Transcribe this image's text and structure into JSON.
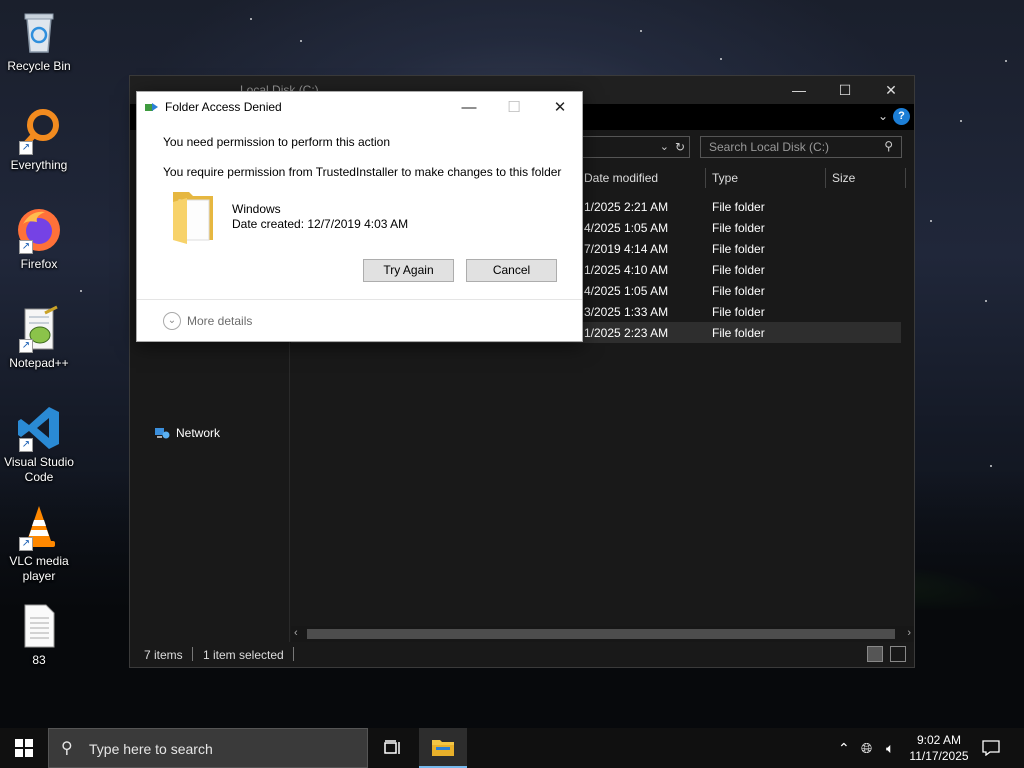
{
  "desktop": {
    "icons": [
      {
        "label": "Recycle Bin",
        "icon": "recycle-bin-icon"
      },
      {
        "label": "Everything",
        "icon": "everything-search-icon"
      },
      {
        "label": "Firefox",
        "icon": "firefox-icon"
      },
      {
        "label": "Notepad++",
        "icon": "notepad-plus-plus-icon"
      },
      {
        "label": "Visual Studio Code",
        "icon": "vscode-icon"
      },
      {
        "label": "VLC media player",
        "icon": "vlc-icon"
      },
      {
        "label": "83",
        "icon": "text-file-icon"
      }
    ]
  },
  "explorer": {
    "title": "Local Disk (C:)",
    "search_placeholder": "Search Local Disk (C:)",
    "columns": [
      "Date modified",
      "Type",
      "Size"
    ],
    "rows": [
      {
        "date": "1/2025 2:21 AM",
        "type": "File folder"
      },
      {
        "date": "4/2025 1:05 AM",
        "type": "File folder"
      },
      {
        "date": "7/2019 4:14 AM",
        "type": "File folder"
      },
      {
        "date": "1/2025 4:10 AM",
        "type": "File folder"
      },
      {
        "date": "4/2025 1:05 AM",
        "type": "File folder"
      },
      {
        "date": "3/2025 1:33 AM",
        "type": "File folder"
      },
      {
        "date": "1/2025 2:23 AM",
        "type": "File folder"
      }
    ],
    "nav_network": "Network",
    "status_items": "7 items",
    "status_selected": "1 item selected"
  },
  "dialog": {
    "title": "Folder Access Denied",
    "message1": "You need permission to perform this action",
    "message2": "You require permission from TrustedInstaller to make changes to this folder",
    "folder_name": "Windows",
    "folder_date": "Date created: 12/7/2019 4:03 AM",
    "try_again": "Try Again",
    "cancel": "Cancel",
    "more_details": "More details"
  },
  "taskbar": {
    "search_placeholder": "Type here to search",
    "time": "9:02 AM",
    "date": "11/17/2025"
  },
  "colors": {
    "accent": "#1c7ed6",
    "folder_yellow": "#f3c544"
  }
}
